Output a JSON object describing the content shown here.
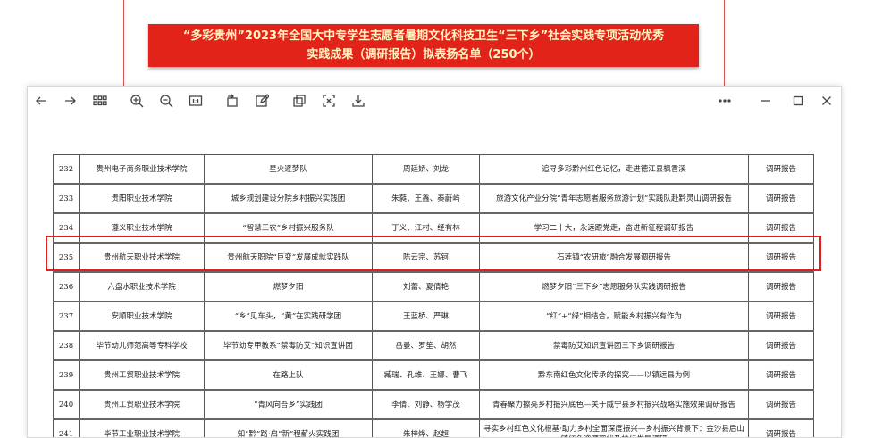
{
  "banner": {
    "line1": "“多彩贵州”2023年全国大中专学生志愿者暑期文化科技卫生“三下乡”社会实践专项活动优秀",
    "line2": "实践成果（调研报告）拟表扬名单（250个）"
  },
  "toolbar": {
    "icons": [
      "back-arrow-icon",
      "forward-arrow-icon",
      "grid-icon",
      "zoom-in-icon",
      "zoom-out-icon",
      "actual-size-icon",
      "rotate-icon",
      "edit-icon",
      "copy-icon",
      "screenshot-icon",
      "download-icon",
      "more-icon",
      "minimize-icon",
      "maximize-icon",
      "close-icon"
    ]
  },
  "table": {
    "rows": [
      [
        "232",
        "贵州电子商务职业技术学院",
        "星火逐梦队",
        "周廷娇、刘龙",
        "追寻多彩黔州红色记忆，走进德江县枫香溪",
        "调研报告"
      ],
      [
        "233",
        "贵阳职业技术学院",
        "城乡规划建设分院乡村振兴实践团",
        "朱蕤、王鑫、秦蔚屿",
        "旅游文化产业分院“青年志愿者服务旅游计划”实践队赴黔灵山调研报告",
        "调研报告"
      ],
      [
        "234",
        "遵义职业技术学院",
        "“智慧三农”乡村振兴服务队",
        "丁义、江村、经有林",
        "学习二十大，永远跟党走，奋进新征程调研报告",
        "调研报告"
      ],
      [
        "235",
        "贵州航天职业技术学院",
        "贵州航天职院“巨变”发展成就实践队",
        "陈云宗、苏钶",
        "石莲镇“农研旅”融合发展调研报告",
        "调研报告"
      ],
      [
        "236",
        "六盘水职业技术学院",
        "燃梦夕阳",
        "刘蕾、夏倩艳",
        "燃梦夕阳“三下乡”志愿服务队实践调研报告",
        "调研报告"
      ],
      [
        "237",
        "安顺职业技术学院",
        "“乡”见车头，“黄”在实践研学团",
        "王蓝桥、严琳",
        "“红”+“绿”相结合，赋能乡村振兴有作为",
        "调研报告"
      ],
      [
        "238",
        "毕节幼儿师范高等专科学校",
        "毕节幼专甲教系“禁毒防艾”知识宣讲团",
        "岳曼、罗笙、胡然",
        "禁毒防艾知识宣讲团三下乡调研报告",
        "调研报告"
      ],
      [
        "239",
        "贵州工贸职业技术学院",
        "在路上队",
        "臧瑞、孔维、王娜、曹飞",
        "黔东南红色文化传承的探究——以镇远县为例",
        "调研报告"
      ],
      [
        "240",
        "贵州工贸职业技术学院",
        "“青风向吾乡”实践团",
        "李倩、刘静、杨学茂",
        "青春聚力擦亮乡村振兴底色—关于威宁县乡村振兴战略实施效果调研报告",
        "调研报告"
      ],
      [
        "241",
        "毕节工业职业技术学院",
        "知“黔”路·启“新”程薪火实践团",
        "朱梓烨、赵超",
        "寻实乡村红色文化根基·助力乡村全面深度振兴—乡村振兴背景下：金沙县后山镇红色资源现状及持续发展调研",
        "调研报告"
      ]
    ]
  }
}
